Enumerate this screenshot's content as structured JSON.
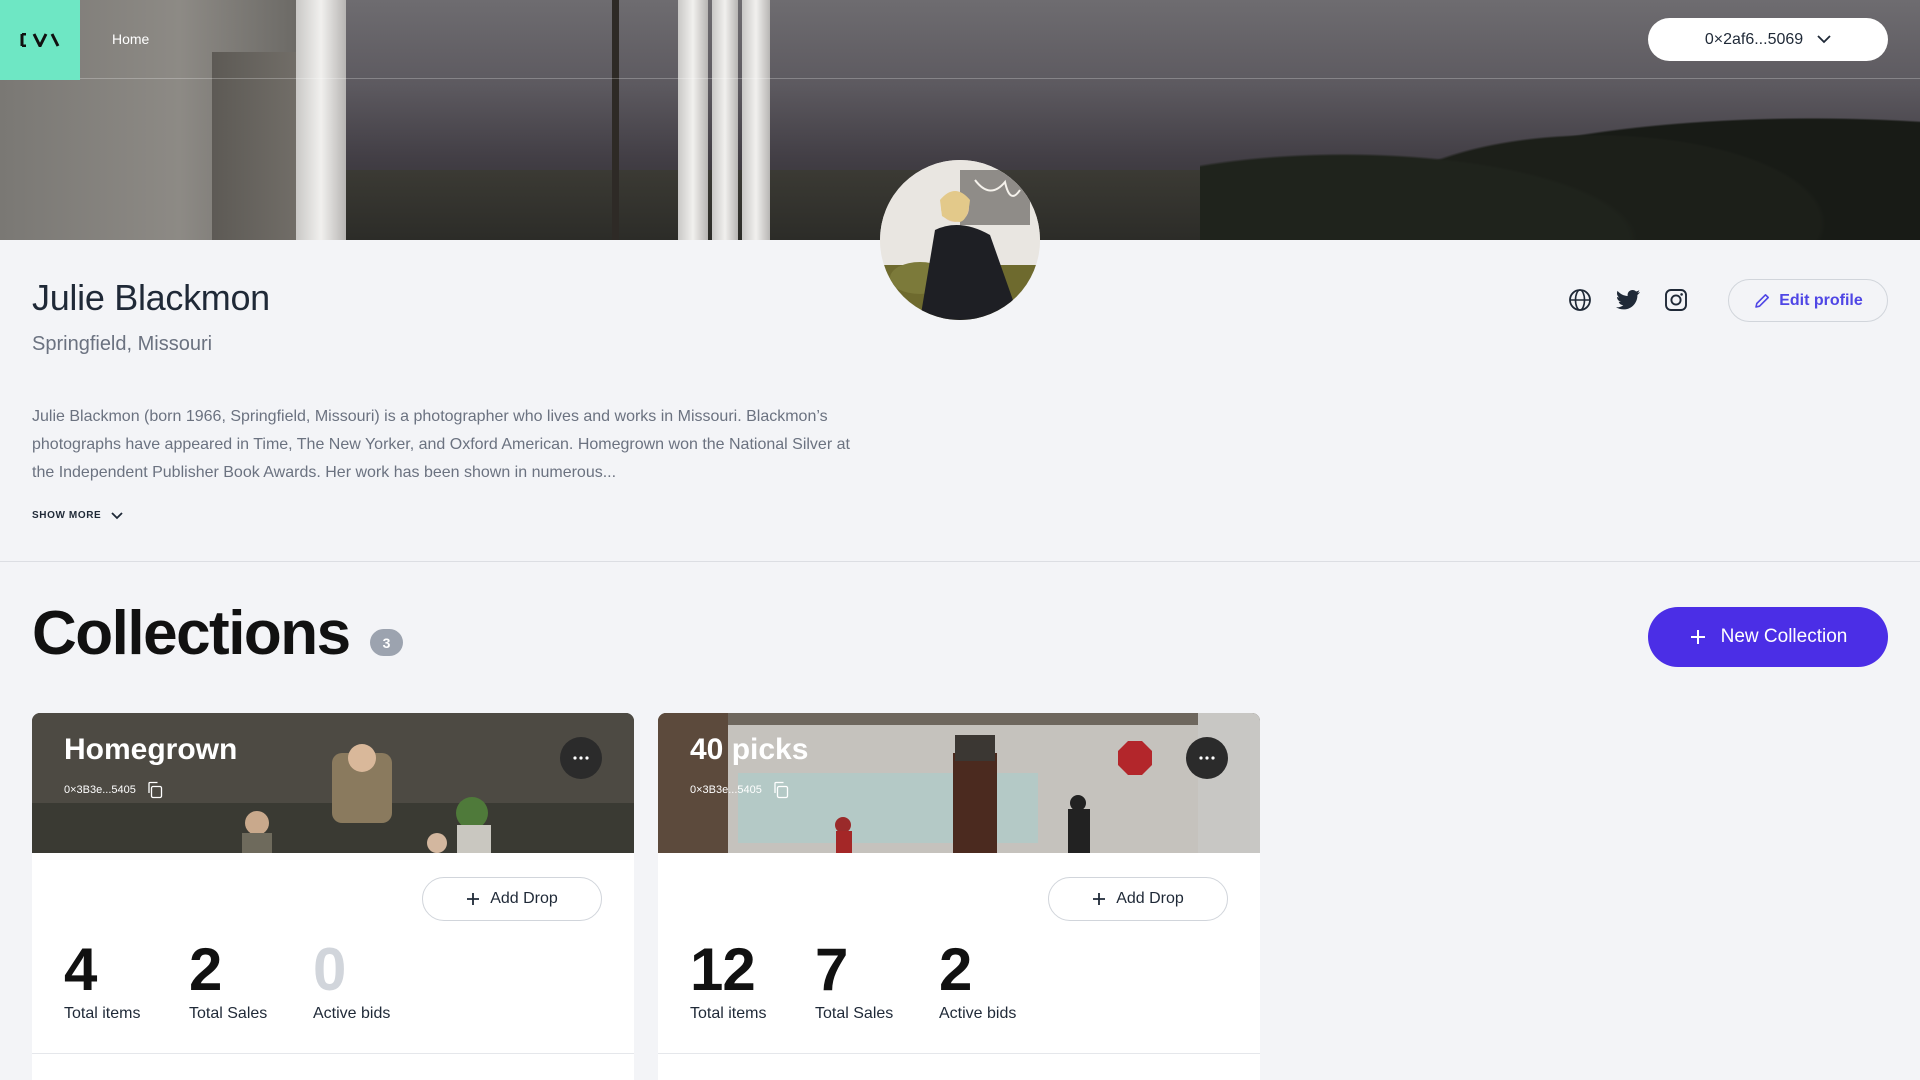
{
  "nav": {
    "home_label": "Home",
    "wallet_label": "0×2af6...5069"
  },
  "profile": {
    "name": "Julie Blackmon",
    "location": "Springfield, Missouri",
    "bio": "Julie Blackmon (born 1966, Springfield, Missouri) is a photographer who lives and works in Missouri. Blackmon’s photographs have appeared in Time, The New Yorker, and Oxford American. Homegrown won the National Silver at the Independent Publisher Book Awards. Her work has been shown in numerous...",
    "show_more_label": "SHOW MORE",
    "edit_label": "Edit profile",
    "social_icons": [
      "globe-icon",
      "twitter-icon",
      "instagram-icon"
    ]
  },
  "collections": {
    "title": "Collections",
    "count": "3",
    "new_label": "New Collection",
    "cards": [
      {
        "title": "Homegrown",
        "address": "0×3B3e...5405",
        "add_drop_label": "Add Drop",
        "stats": [
          {
            "value": "4",
            "label": "Total items"
          },
          {
            "value": "2",
            "label": "Total Sales"
          },
          {
            "value": "0",
            "label": "Active bids"
          }
        ]
      },
      {
        "title": "40 picks",
        "address": "0×3B3e...5405",
        "add_drop_label": "Add Drop",
        "stats": [
          {
            "value": "12",
            "label": "Total items"
          },
          {
            "value": "7",
            "label": "Total Sales"
          },
          {
            "value": "2",
            "label": "Active bids"
          }
        ]
      }
    ]
  },
  "colors": {
    "accent": "#4b2ee6",
    "logo_bg": "#6ee7c4",
    "edit_text": "#4f46e5"
  }
}
